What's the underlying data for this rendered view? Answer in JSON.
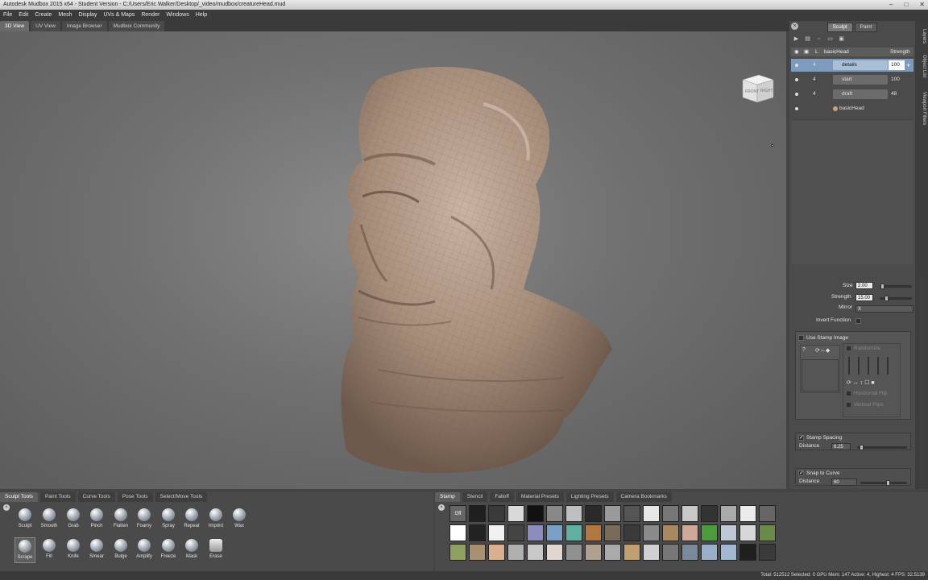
{
  "window": {
    "title": "Autodesk Mudbox 2015 x64 - Student Version - C:/Users/Eric Walker/Desktop/_video/mudbox/creatureHead.mud",
    "min": "–",
    "max": "□",
    "close": "✕"
  },
  "menu": [
    "File",
    "Edit",
    "Create",
    "Mesh",
    "Display",
    "UVs & Maps",
    "Render",
    "Windows",
    "Help"
  ],
  "view_tabs": [
    "3D View",
    "UV View",
    "Image Browser",
    "Mudbox Community"
  ],
  "viewcube": {
    "front": "FRONT",
    "right": "RIGHT"
  },
  "right_panel": {
    "tabs": [
      "Sculpt",
      "Paint"
    ],
    "header": {
      "level": "L",
      "name": "basicHead",
      "strength": "Strength"
    },
    "layers": [
      {
        "level": "4",
        "name": "details",
        "strength": "100",
        "selected": true
      },
      {
        "level": "4",
        "name": "start",
        "strength": "100",
        "selected": false
      },
      {
        "level": "4",
        "name": "draft",
        "strength": "48",
        "selected": false
      }
    ],
    "base": {
      "name": "basicHead"
    },
    "side_tabs": [
      "Layers",
      "Object List",
      "Viewport Filters"
    ]
  },
  "properties": {
    "size_label": "Size",
    "size_value": "2.00",
    "strength_label": "Strength",
    "strength_value": "15.00",
    "mirror_label": "Mirror",
    "mirror_value": "X",
    "invert_label": "Invert Function",
    "stamp_image_label": "Use Stamp Image",
    "randomize_label": "Randomize",
    "horizontal_flip_label": "Horizontal Flip",
    "vertical_flips_label": "Vertical Flips",
    "stamp_spacing_label": "Stamp Spacing",
    "distance_label": "Distance",
    "distance_value": "6.25",
    "snap_label": "Snap to Curve",
    "distance2_label": "Distance",
    "distance2_value": "60"
  },
  "tool_tabs": [
    "Sculpt Tools",
    "Paint Tools",
    "Curve Tools",
    "Pose Tools",
    "Select/Move Tools"
  ],
  "tools_row1": [
    "Sculpt",
    "Smooth",
    "Grab",
    "Pinch",
    "Flatten",
    "Foamy",
    "Spray",
    "Repeat",
    "Imprint",
    "Wax"
  ],
  "tools_row2": [
    "Scrape",
    "Fill",
    "Knife",
    "Smear",
    "Bulge",
    "Amplify",
    "Freeze",
    "Mask",
    "Erase"
  ],
  "tray_tabs": [
    "Stamp",
    "Stencil",
    "Falloff",
    "Material Presets",
    "Lighting Presets",
    "Camera Bookmarks"
  ],
  "stamp_off": "Off",
  "status": "Total: 512512  Selected: 0 GPU Mem: 147  Active: 4, Highest: 4  FPS: 32.5139",
  "colors": {
    "selected_layer": "#7c9bbd",
    "skin": "#a68d7a",
    "viewport_bg": "#707070"
  },
  "icons": {
    "close": "close-icon",
    "eye": "eye-icon",
    "stamp": "stamp-swatch"
  }
}
